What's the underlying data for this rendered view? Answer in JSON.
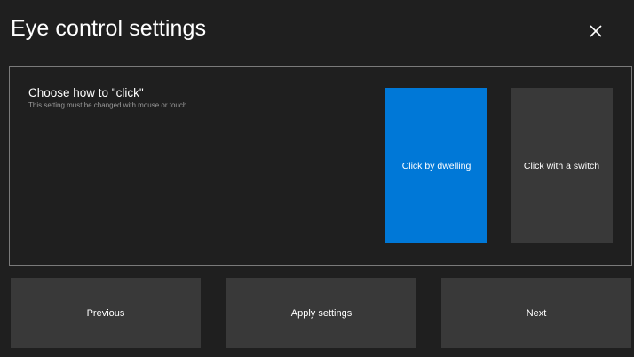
{
  "header": {
    "title": "Eye control settings",
    "close_icon": "close-icon"
  },
  "click_setting": {
    "label": "Choose how to \"click\"",
    "hint": "This setting must be changed with mouse or touch.",
    "options": [
      {
        "label": "Click by dwelling",
        "selected": true
      },
      {
        "label": "Click with a switch",
        "selected": false
      }
    ]
  },
  "footer": {
    "previous_label": "Previous",
    "apply_label": "Apply settings",
    "next_label": "Next"
  },
  "colors": {
    "background": "#1f1f1f",
    "accent": "#0078d7",
    "button": "#393939",
    "border": "#7a7a7a"
  }
}
